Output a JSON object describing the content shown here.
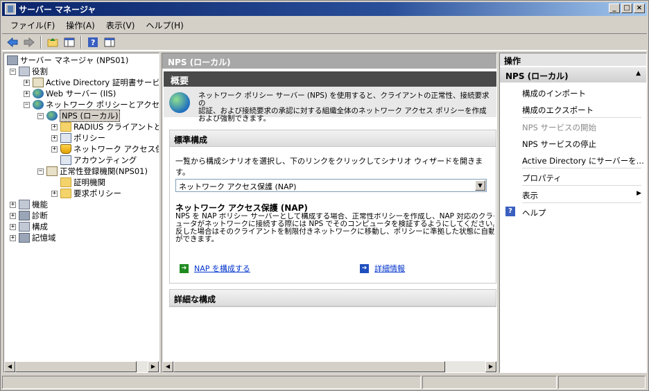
{
  "window": {
    "title": "サーバー マネージャ"
  },
  "menu": [
    "ファイル(F)",
    "操作(A)",
    "表示(V)",
    "ヘルプ(H)"
  ],
  "tree": {
    "root": "サーバー マネージャ (NPS01)",
    "roles": "役割",
    "adcs": "Active Directory 証明書サービス",
    "iis": "Web サーバー (IIS)",
    "npas": "ネットワーク ポリシーとアクセス サービス",
    "nps": "NPS (ローカル)",
    "radius": "RADIUS クライアントとサーバー",
    "policies": "ポリシー",
    "nap": "ネットワーク アクセス保護",
    "accounting": "アカウンティング",
    "hra": "正常性登録機関(NPS01)",
    "ca": "証明機関",
    "req_policy": "要求ポリシー",
    "features": "機能",
    "diagnostics": "診断",
    "configuration": "構成",
    "storage": "記憶域"
  },
  "center": {
    "breadcrumb": "NPS (ローカル)",
    "overview_title": "概要",
    "overview_text": [
      "ネットワーク ポリシー サーバー (NPS) を使用すると、クライアントの正常性、接続要求の",
      "認証、および接続要求の承認に対する組織全体のネットワーク アクセス ポリシーを作成",
      "および強制できます。"
    ],
    "standard_title": "標準構成",
    "standard_desc": "一覧から構成シナリオを選択し、下のリンクをクリックしてシナリオ ウィザードを開きます。",
    "scenario_selected": "ネットワーク アクセス保護 (NAP)",
    "nap_title": "ネットワーク アクセス保護 (NAP)",
    "nap_text": [
      "NPS を NAP ポリシー サーバーとして構成する場合、正常性ポリシーを作成し、NAP 対応のクライアントコンピ",
      "ュータがネットワークに接続する際には NPS でそのコンピュータを検証するようにしてください。正常性ポリシーに違",
      "反した場合はそのクライアントを制限付きネットワークに移動し、ポリシーに準拠した状態に自動的に更新すること",
      "ができます。"
    ],
    "link_configure": "NAP を構成する",
    "link_details": "詳細情報",
    "advanced_title": "詳細な構成"
  },
  "actions": {
    "header": "操作",
    "group": "NPS (ローカル)",
    "import": "構成のインポート",
    "export": "構成のエクスポート",
    "start": "NPS サービスの開始",
    "stop": "NPS サービスの停止",
    "register": "Active Directory にサーバーを...",
    "properties": "プロパティ",
    "view": "表示",
    "help": "ヘルプ"
  }
}
